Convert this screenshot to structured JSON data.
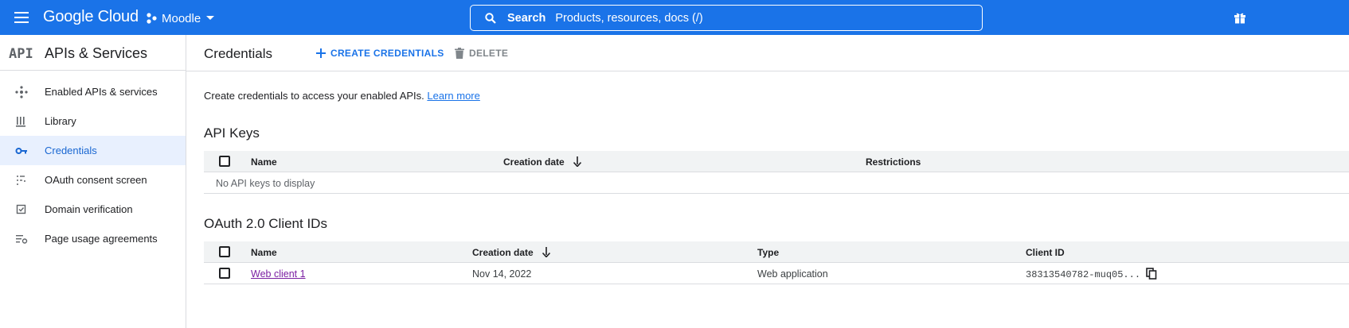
{
  "topbar": {
    "brand": "Google Cloud",
    "project": "Moodle",
    "search_label": "Search",
    "search_placeholder": "Products, resources, docs (/)"
  },
  "sidebar": {
    "logo_text": "API",
    "title": "APIs & Services",
    "items": [
      {
        "label": "Enabled APIs & services",
        "icon": "hub-icon"
      },
      {
        "label": "Library",
        "icon": "library-icon"
      },
      {
        "label": "Credentials",
        "icon": "key-icon",
        "active": true
      },
      {
        "label": "OAuth consent screen",
        "icon": "consent-icon"
      },
      {
        "label": "Domain verification",
        "icon": "checkbox-icon"
      },
      {
        "label": "Page usage agreements",
        "icon": "settings-list-icon"
      }
    ]
  },
  "header": {
    "title": "Credentials",
    "create_label": "CREATE CREDENTIALS",
    "delete_label": "DELETE"
  },
  "intro": {
    "text": "Create credentials to access your enabled APIs.",
    "link": "Learn more"
  },
  "api_keys": {
    "title": "API Keys",
    "columns": [
      "Name",
      "Creation date",
      "Restrictions"
    ],
    "empty": "No API keys to display"
  },
  "oauth": {
    "title": "OAuth 2.0 Client IDs",
    "columns": [
      "Name",
      "Creation date",
      "Type",
      "Client ID"
    ],
    "rows": [
      {
        "name": "Web client 1",
        "date": "Nov 14, 2022",
        "type": "Web application",
        "client_id": "38313540782-muq05..."
      }
    ]
  },
  "colors": {
    "topbar": "#1a73e8",
    "accent": "#1a73e8",
    "active_bg": "#e8f0fe",
    "link_visited": "#7b1fa2"
  }
}
